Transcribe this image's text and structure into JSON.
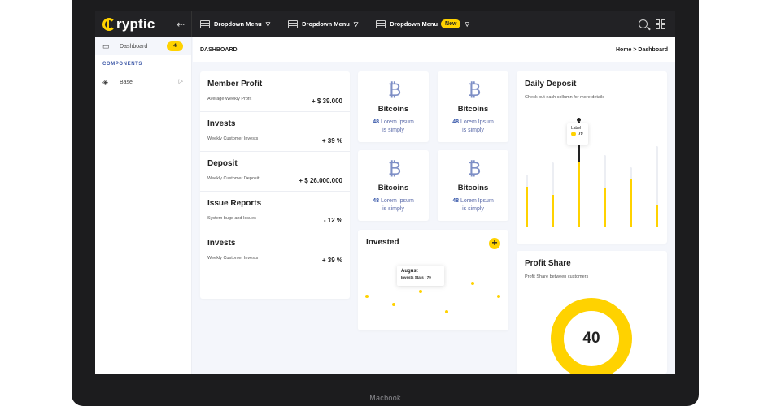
{
  "device": {
    "label": "Macbook"
  },
  "brand": {
    "name": "ryptic"
  },
  "topbar": {
    "menus": [
      {
        "label": "Dropdown Menu"
      },
      {
        "label": "Dropdown Menu"
      },
      {
        "label": "Dropdown Menu",
        "badge": "New"
      }
    ]
  },
  "sidebar": {
    "items": [
      {
        "label": "Dashboard",
        "badge": "4"
      },
      {
        "label": "Base"
      }
    ],
    "section_label": "COMPONENTS"
  },
  "breadcrumb": {
    "title": "DASHBOARD",
    "path": "Home > Dashboard"
  },
  "stats": [
    {
      "title": "Member Profit",
      "subtitle": "Average Weekly Profit",
      "value": "+ $ 39.000"
    },
    {
      "title": "Invests",
      "subtitle": "Weekly Customer Invests",
      "value": "+ 39 %"
    },
    {
      "title": "Deposit",
      "subtitle": "Weekly Customer Deposit",
      "value": "+ $ 26.000.000"
    },
    {
      "title": "Issue Reports",
      "subtitle": "System bugs and Issues",
      "value": "- 12 %"
    },
    {
      "title": "Invests",
      "subtitle": "Weekly Customer Invests",
      "value": "+ 39 %"
    }
  ],
  "coins": [
    {
      "symbol": "₿",
      "title": "Bitcoins",
      "number": "48",
      "line1": "Lorem Ipsum",
      "line2": "is simply"
    },
    {
      "symbol": "₿",
      "title": "Bitcoins",
      "number": "48",
      "line1": "Lorem Ipsum",
      "line2": "is simply"
    },
    {
      "symbol": "₿",
      "title": "Bitcoins",
      "number": "48",
      "line1": "Lorem Ipsum",
      "line2": "is simply"
    },
    {
      "symbol": "₿",
      "title": "Bitcoins",
      "number": "48",
      "line1": "Lorem Ipsum",
      "line2": "is simply"
    }
  ],
  "invested": {
    "title": "Invested",
    "add_label": "+",
    "tooltip_title": "August",
    "tooltip_text": "Invests Stats : 79",
    "colors": {
      "point": "#ffd200"
    }
  },
  "daily_deposit": {
    "title": "Daily Deposit",
    "subtitle": "Check out each collumn for more details",
    "tooltip_title": "Label",
    "tooltip_value": "79"
  },
  "profit_share": {
    "title": "Profit Share",
    "subtitle": "Profit Share between customers",
    "value": "40"
  },
  "colors": {
    "accent": "#ffd200",
    "dark": "#222225",
    "link": "#3354a8"
  }
}
